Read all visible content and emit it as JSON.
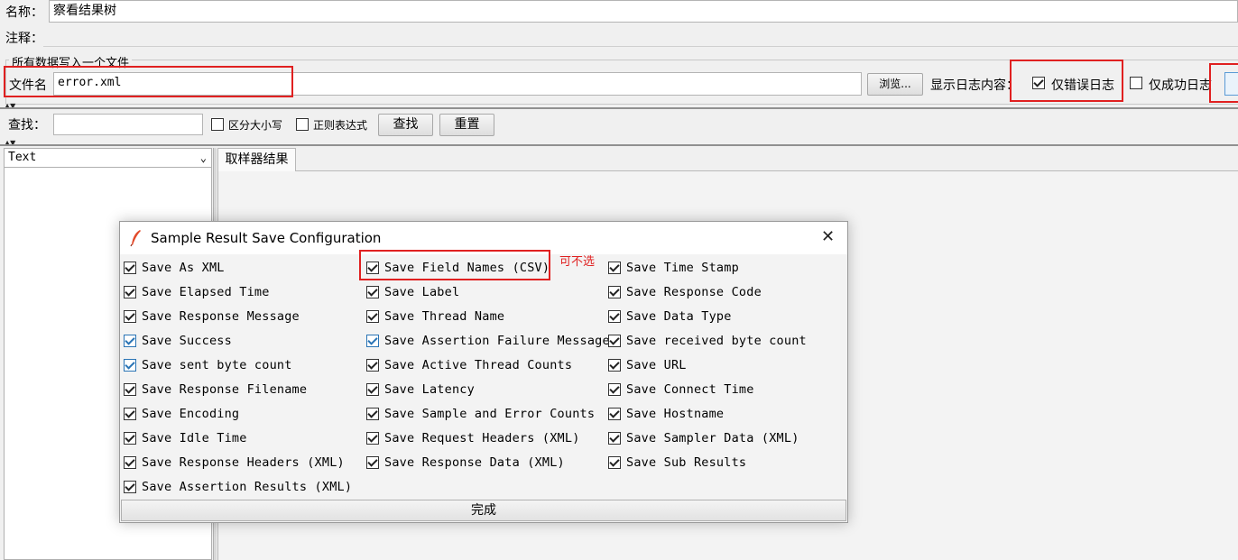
{
  "form": {
    "name_label": "名称：",
    "name_value": "察看结果树",
    "comment_label": "注释：",
    "comment_value": ""
  },
  "file_section": {
    "group_title": "所有数据写入一个文件",
    "filename_label": "文件名",
    "filename_value": "error.xml",
    "browse_label": "浏览...",
    "log_content_label": "显示日志内容：",
    "errors_only_label": "仅错误日志",
    "errors_only_checked": true,
    "success_only_label": "仅成功日志",
    "success_only_checked": false
  },
  "search_bar": {
    "label": "查找：",
    "value": "",
    "case_label": "区分大小写",
    "case_checked": false,
    "regex_label": "正则表达式",
    "regex_checked": false,
    "find_label": "查找",
    "reset_label": "重置"
  },
  "left_panel": {
    "renderer_selected": "Text"
  },
  "tabs": [
    "取样器结果"
  ],
  "dialog": {
    "title": "Sample Result Save Configuration",
    "annotation": "可不选",
    "done_label": "完成",
    "options": [
      {
        "label": "Save As XML",
        "checked": true
      },
      {
        "label": "Save Field Names (CSV)",
        "checked": true
      },
      {
        "label": "Save Time Stamp",
        "checked": true
      },
      {
        "label": "Save Elapsed Time",
        "checked": true
      },
      {
        "label": "Save Label",
        "checked": true
      },
      {
        "label": "Save Response Code",
        "checked": true
      },
      {
        "label": "Save Response Message",
        "checked": true
      },
      {
        "label": "Save Thread Name",
        "checked": true
      },
      {
        "label": "Save Data Type",
        "checked": true
      },
      {
        "label": "Save Success",
        "checked": true,
        "accent": "blue"
      },
      {
        "label": "Save Assertion Failure Message",
        "checked": true,
        "accent": "blue"
      },
      {
        "label": "Save received byte count",
        "checked": true
      },
      {
        "label": "Save sent byte count",
        "checked": true,
        "accent": "blue"
      },
      {
        "label": "Save Active Thread Counts",
        "checked": true
      },
      {
        "label": "Save URL",
        "checked": true
      },
      {
        "label": "Save Response Filename",
        "checked": true
      },
      {
        "label": "Save Latency",
        "checked": true
      },
      {
        "label": "Save Connect Time",
        "checked": true
      },
      {
        "label": "Save Encoding",
        "checked": true
      },
      {
        "label": "Save Sample and Error Counts",
        "checked": true
      },
      {
        "label": "Save Hostname",
        "checked": true
      },
      {
        "label": "Save Idle Time",
        "checked": true
      },
      {
        "label": "Save Request Headers (XML)",
        "checked": true
      },
      {
        "label": "Save Sampler Data (XML)",
        "checked": true
      },
      {
        "label": "Save Response Headers (XML)",
        "checked": true
      },
      {
        "label": "Save Response Data (XML)",
        "checked": true
      },
      {
        "label": "Save Sub Results",
        "checked": true
      },
      {
        "label": "Save Assertion Results (XML)",
        "checked": true
      }
    ]
  },
  "colors": {
    "highlight_red": "#e02020",
    "checkbox_blue": "#2a74b5"
  }
}
